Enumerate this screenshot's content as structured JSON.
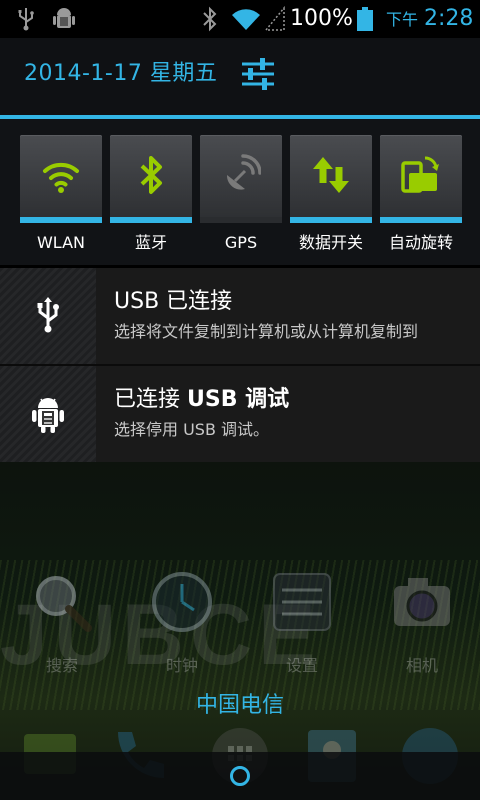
{
  "status_bar": {
    "battery_percent": "100%",
    "ampm": "下午",
    "time": "2:28",
    "icons": [
      "usb-icon",
      "android-debug-icon",
      "bluetooth-icon",
      "wifi-icon",
      "signal-icon",
      "battery-icon"
    ]
  },
  "header": {
    "date": "2014-1-17 星期五",
    "settings_icon": "settings-sliders-icon"
  },
  "toggles": [
    {
      "label": "WLAN",
      "icon": "wifi-icon",
      "state": "on"
    },
    {
      "label": "蓝牙",
      "icon": "bluetooth-icon",
      "state": "on"
    },
    {
      "label": "GPS",
      "icon": "gps-icon",
      "state": "off"
    },
    {
      "label": "数据开关",
      "icon": "mobile-data-icon",
      "state": "on"
    },
    {
      "label": "自动旋转",
      "icon": "auto-rotate-icon",
      "state": "on"
    }
  ],
  "notifications": [
    {
      "icon": "usb-icon",
      "title": "USB 已连接",
      "text": "选择将文件复制到计算机或从计算机复制到"
    },
    {
      "icon": "android-debug-icon",
      "title_prefix": "已连接 ",
      "title_bold": "USB 调试",
      "text": "选择停用 USB 调试。"
    }
  ],
  "home": {
    "bg_text": "JUBCE",
    "apps": [
      {
        "label": "搜索",
        "icon": "search-icon"
      },
      {
        "label": "时钟",
        "icon": "clock-icon"
      },
      {
        "label": "设置",
        "icon": "settings-icon"
      },
      {
        "label": "相机",
        "icon": "camera-icon"
      }
    ],
    "carrier": "中国电信",
    "dock_icons": [
      "messaging-icon",
      "phone-icon",
      "app-drawer-icon",
      "contacts-icon",
      "browser-icon"
    ]
  },
  "colors": {
    "accent": "#33b5e5",
    "toggle_green": "#99cc00",
    "toggle_off": "#7a7a7a"
  }
}
